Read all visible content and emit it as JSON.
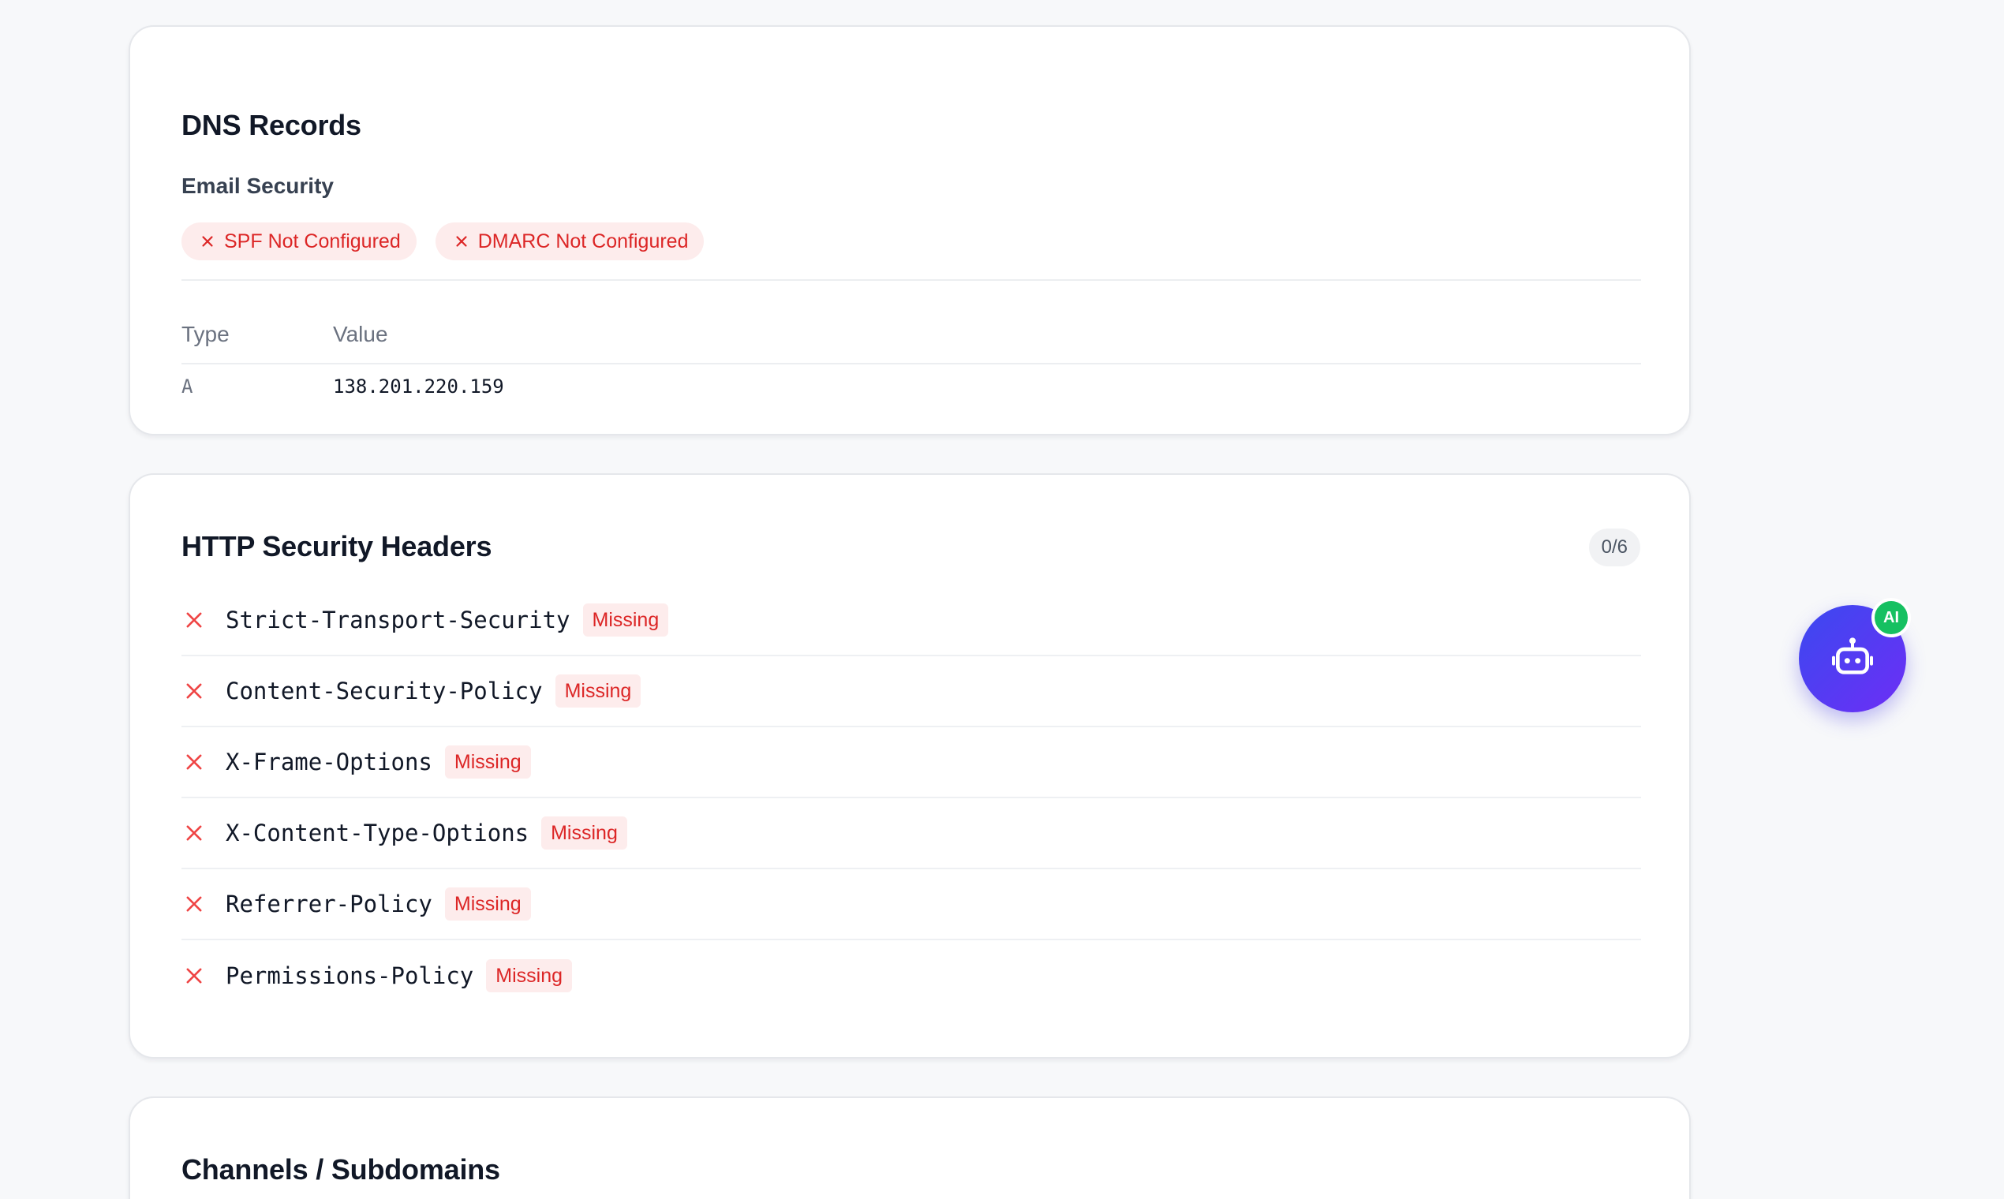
{
  "dns_records": {
    "title": "DNS Records",
    "email_security": {
      "label": "Email Security",
      "pills": [
        {
          "icon": "close-icon",
          "label": "SPF Not Configured"
        },
        {
          "icon": "close-icon",
          "label": "DMARC Not Configured"
        }
      ]
    },
    "table": {
      "columns": [
        "Type",
        "Value"
      ],
      "rows": [
        {
          "type": "A",
          "value": "138.201.220.159"
        }
      ]
    }
  },
  "http_headers": {
    "title": "HTTP Security Headers",
    "count": "0/6",
    "items": [
      {
        "icon": "close-icon",
        "name": "Strict-Transport-Security",
        "status": "Missing"
      },
      {
        "icon": "close-icon",
        "name": "Content-Security-Policy",
        "status": "Missing"
      },
      {
        "icon": "close-icon",
        "name": "X-Frame-Options",
        "status": "Missing"
      },
      {
        "icon": "close-icon",
        "name": "X-Content-Type-Options",
        "status": "Missing"
      },
      {
        "icon": "close-icon",
        "name": "Referrer-Policy",
        "status": "Missing"
      },
      {
        "icon": "close-icon",
        "name": "Permissions-Policy",
        "status": "Missing"
      }
    ]
  },
  "channels": {
    "title": "Channels / Subdomains"
  },
  "ai_assistant": {
    "icon": "robot-icon",
    "badge": "AI"
  },
  "colors": {
    "danger": "#dc2626",
    "danger_bg": "#fdecec",
    "accent_start": "#3b49f0",
    "accent_end": "#6d2ef5",
    "ai_badge": "#16c061"
  }
}
